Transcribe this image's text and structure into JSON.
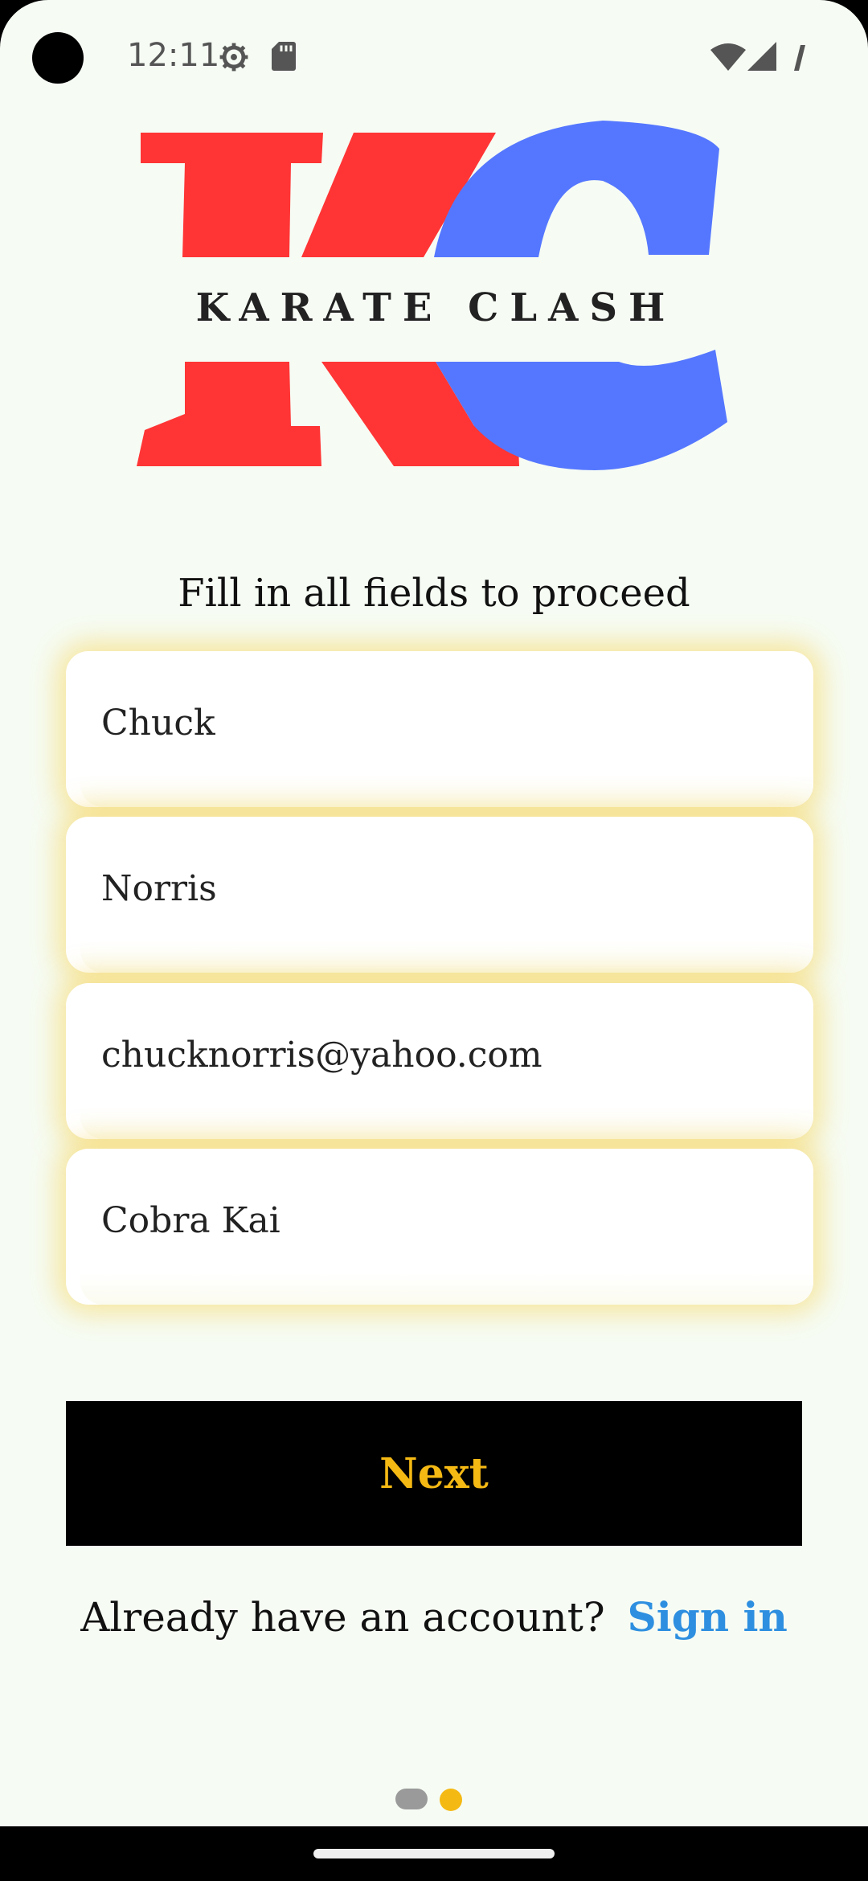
{
  "status_bar": {
    "time": "12:11",
    "icons": [
      "camera-cutout",
      "gear-icon",
      "sd-card-icon",
      "wifi-icon",
      "signal-icon",
      "battery-icon"
    ]
  },
  "logo": {
    "text": "KARATE CLASH",
    "letters": "KC",
    "colors": {
      "red": "#ff3535",
      "blue": "#5577ff"
    }
  },
  "form": {
    "instruction": "Fill in all fields to proceed",
    "fields": [
      {
        "value": "Chuck",
        "placeholder": ""
      },
      {
        "value": "Norris",
        "placeholder": ""
      },
      {
        "value": "chucknorris@yahoo.com",
        "placeholder": ""
      },
      {
        "value": "Cobra Kai",
        "placeholder": ""
      }
    ],
    "next_label": "Next"
  },
  "signin": {
    "prompt": "Already have an account?",
    "link": "Sign in"
  },
  "pager": {
    "pages": 2,
    "active_index": 1
  },
  "colors": {
    "background": "#f6fcf4",
    "accent_yellow": "#f5b914",
    "link_blue": "#2e8fe0",
    "button_black": "#000000"
  }
}
